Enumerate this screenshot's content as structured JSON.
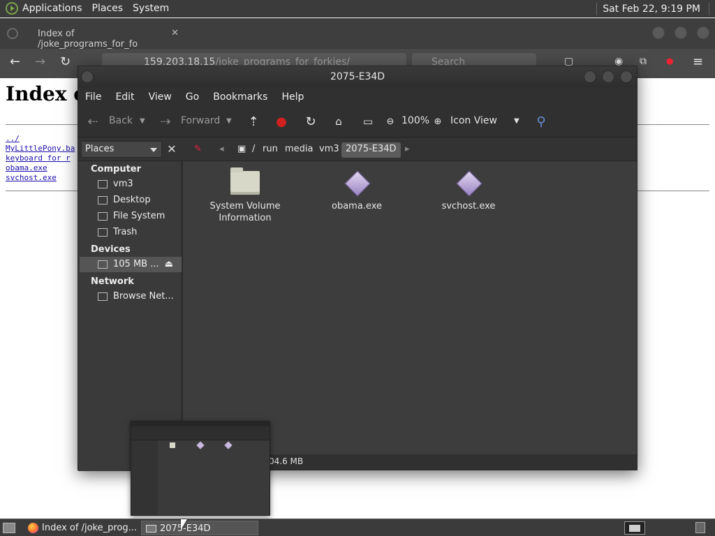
{
  "top_panel": {
    "menus": [
      "Applications",
      "Places",
      "System"
    ],
    "clock": "Sat Feb 22,  9:19 PM"
  },
  "browser": {
    "tab_title": "Index of /joke_programs_for_fo",
    "url_host": "159.203.18.15",
    "url_path": "/joke_programs_for_forkies/",
    "search_placeholder": "Search"
  },
  "page": {
    "heading": "Index of",
    "links": [
      "../",
      "MyLittlePony.ba",
      "keyboard for r",
      "obama.exe",
      "svchost.exe"
    ]
  },
  "file_manager": {
    "title": "2075-E34D",
    "menu": [
      "File",
      "Edit",
      "View",
      "Go",
      "Bookmarks",
      "Help"
    ],
    "toolbar": {
      "back": "Back",
      "forward": "Forward",
      "zoom": "100%",
      "view_mode": "Icon View"
    },
    "places_label": "Places",
    "breadcrumbs": [
      "/",
      "run",
      "media",
      "vm3",
      "2075-E34D"
    ],
    "sidebar": {
      "computer_header": "Computer",
      "computer_items": [
        "vm3",
        "Desktop",
        "File System",
        "Trash"
      ],
      "devices_header": "Devices",
      "device_items": [
        "105 MB ..."
      ],
      "network_header": "Network",
      "network_items": [
        "Browse Net..."
      ]
    },
    "files": [
      {
        "name": "System Volume Information",
        "icon": "folder-icon"
      },
      {
        "name": "obama.exe",
        "icon": "exe-icon"
      },
      {
        "name": "svchost.exe",
        "icon": "exe-icon"
      }
    ],
    "status": "04.6 MB"
  },
  "taskbar": {
    "tasks": [
      "Index of /joke_prog...",
      "2075-E34D"
    ]
  }
}
